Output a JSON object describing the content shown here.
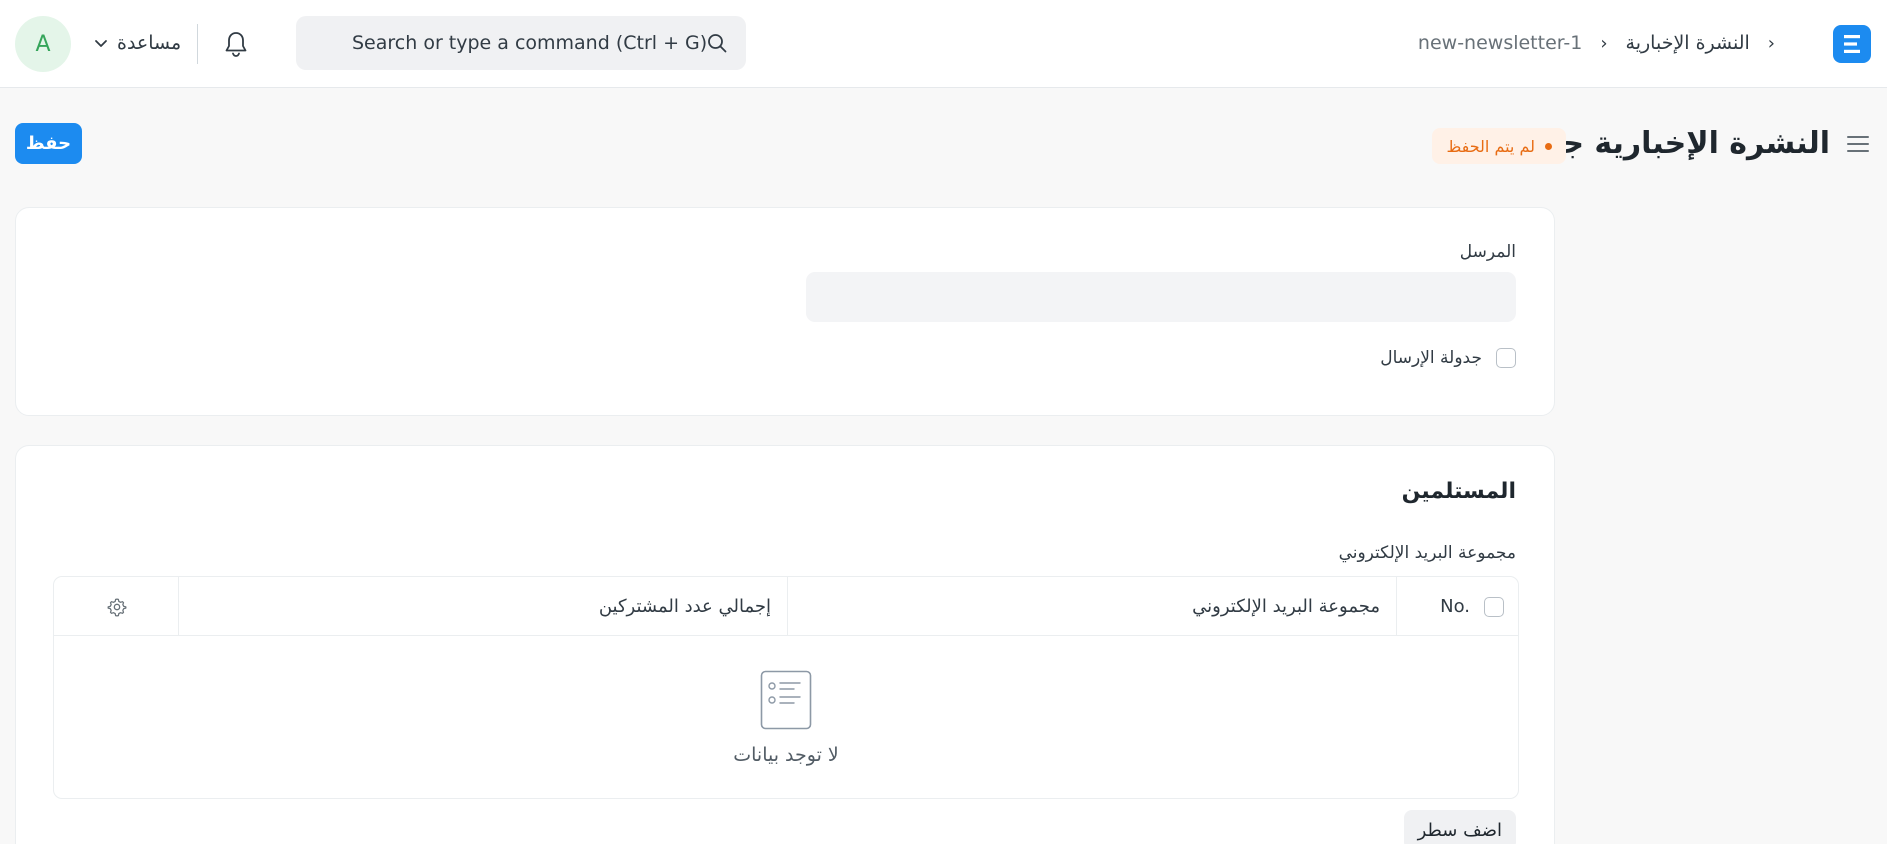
{
  "user": {
    "initial": "A"
  },
  "navbar": {
    "help_label": "مساعدة",
    "search_placeholder": "Search or type a command (Ctrl + G)",
    "breadcrumbs": [
      "النشرة الإخبارية",
      "new-newsletter-1"
    ]
  },
  "page": {
    "title": "النشرة الإخبارية جديد",
    "status": "لم يتم الحفظ",
    "save_label": "حفظ"
  },
  "form": {
    "sender_label": "المرسل",
    "sender_value": "",
    "schedule_label": "جدولة الإرسال",
    "recipients": {
      "section_title": "المستلمين",
      "field_label": "مجموعة البريد الإلكتروني",
      "columns": {
        "no": "No.",
        "email_group": "مجموعة البريد الإلكتروني",
        "total_subscribers": "إجمالي عدد المشتركين"
      },
      "empty_text": "لا توجد بيانات",
      "add_row_label": "اضف سطر"
    }
  },
  "colors": {
    "primary": "#1c8bf0",
    "status_text": "#e86c13",
    "status_bg": "#fff1e7",
    "avatar_bg": "#e4f5e9",
    "avatar_text": "#36a55b"
  },
  "icons": [
    "chevron-down-icon",
    "bell-icon",
    "search-icon",
    "app-logo-icon",
    "hamburger-icon",
    "gear-icon",
    "empty-list-icon"
  ]
}
